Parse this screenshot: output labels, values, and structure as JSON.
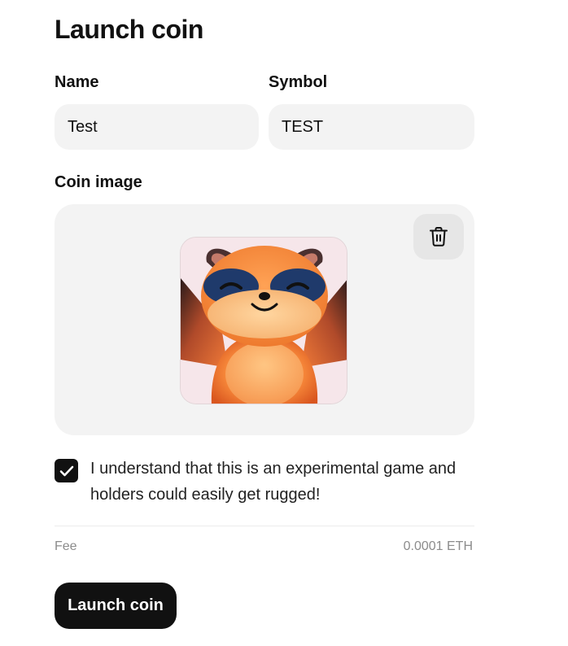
{
  "page": {
    "title": "Launch coin"
  },
  "form": {
    "name": {
      "label": "Name",
      "value": "Test"
    },
    "symbol": {
      "label": "Symbol",
      "value": "TEST"
    },
    "coin_image": {
      "label": "Coin image",
      "delete_icon": "trash-icon",
      "image_subject": "raccoon-mascot"
    },
    "consent": {
      "checked": true,
      "text": "I understand that this is an experimental game and holders could easily get rugged!"
    },
    "fee": {
      "label": "Fee",
      "value": "0.0001 ETH"
    },
    "submit_label": "Launch coin"
  },
  "colors": {
    "primary": "#111111",
    "field_bg": "#f3f3f3",
    "muted_text": "#8c8c8c"
  }
}
